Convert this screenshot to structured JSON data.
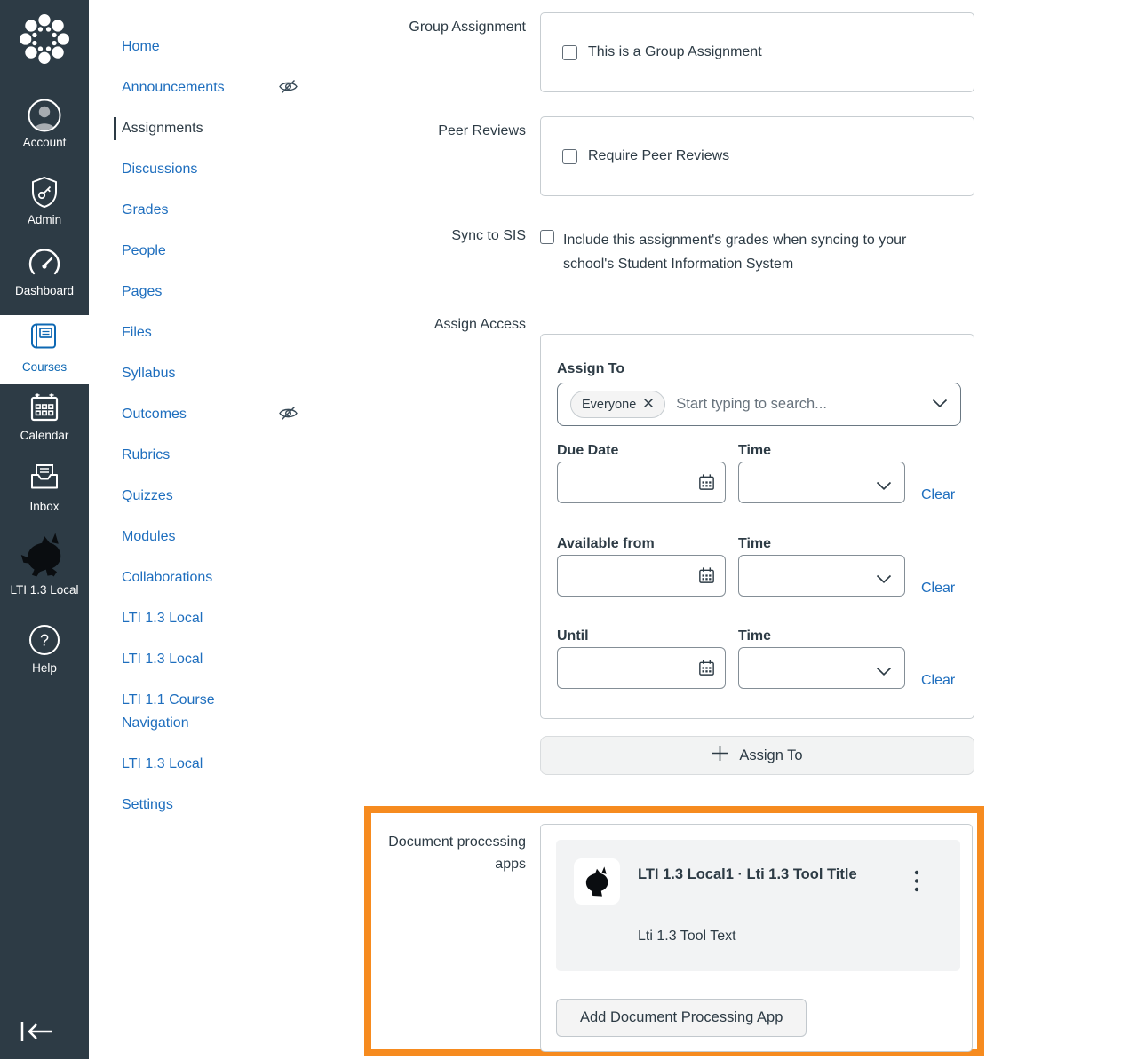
{
  "colors": {
    "sidebar_bg": "#2D3B45",
    "brand_blue": "#0E68B3",
    "link_blue": "#1E6EBE",
    "text_dark": "#2D3B45",
    "highlight_orange": "#F68B1F",
    "panel_border": "#C7CDD1",
    "card_gray_bg": "#F2F3F4"
  },
  "sidebar": {
    "items": [
      {
        "label": "Account",
        "icon": "user-icon"
      },
      {
        "label": "Admin",
        "icon": "shield-key-icon"
      },
      {
        "label": "Dashboard",
        "icon": "gauge-icon"
      },
      {
        "label": "Courses",
        "icon": "book-icon",
        "active": true
      },
      {
        "label": "Calendar",
        "icon": "calendar-icon"
      },
      {
        "label": "Inbox",
        "icon": "inbox-tray-icon"
      },
      {
        "label": "LTI 1.3 Local",
        "icon": "unicorn-icon"
      },
      {
        "label": "Help",
        "icon": "question-icon"
      }
    ]
  },
  "course_nav": {
    "items": [
      {
        "label": "Home"
      },
      {
        "label": "Announcements",
        "hidden": true
      },
      {
        "label": "Assignments",
        "active": true
      },
      {
        "label": "Discussions"
      },
      {
        "label": "Grades"
      },
      {
        "label": "People"
      },
      {
        "label": "Pages"
      },
      {
        "label": "Files"
      },
      {
        "label": "Syllabus"
      },
      {
        "label": "Outcomes",
        "hidden": true
      },
      {
        "label": "Rubrics"
      },
      {
        "label": "Quizzes"
      },
      {
        "label": "Modules"
      },
      {
        "label": "Collaborations"
      },
      {
        "label": "LTI 1.3 Local"
      },
      {
        "label": "LTI 1.3 Local"
      },
      {
        "label": "LTI 1.1 Course Navigation"
      },
      {
        "label": "LTI 1.3 Local"
      },
      {
        "label": "Settings"
      }
    ]
  },
  "form": {
    "group_assignment": {
      "label": "Group Assignment",
      "checkbox_label": "This is a Group Assignment",
      "checked": false
    },
    "peer_reviews": {
      "label": "Peer Reviews",
      "checkbox_label": "Require Peer Reviews",
      "checked": false
    },
    "sync_to_sis": {
      "label": "Sync to SIS",
      "checkbox_label": "Include this assignment's grades when syncing to your school's Student Information System",
      "checked": false
    },
    "assign_access": {
      "label": "Assign Access",
      "assign_to_heading": "Assign To",
      "selected_tag": "Everyone",
      "search_placeholder": "Start typing to search...",
      "rows": [
        {
          "date_label": "Due Date",
          "time_label": "Time",
          "clear_label": "Clear",
          "date_value": "",
          "time_value": ""
        },
        {
          "date_label": "Available from",
          "time_label": "Time",
          "clear_label": "Clear",
          "date_value": "",
          "time_value": ""
        },
        {
          "date_label": "Until",
          "time_label": "Time",
          "clear_label": "Clear",
          "date_value": "",
          "time_value": ""
        }
      ]
    },
    "assign_to_button_label": "Assign To",
    "document_processing": {
      "label": "Document processing apps",
      "app_title": "LTI 1.3 Local1 · Lti 1.3 Tool Title",
      "app_description": "Lti 1.3 Tool Text",
      "add_button_label": "Add Document Processing App"
    }
  }
}
